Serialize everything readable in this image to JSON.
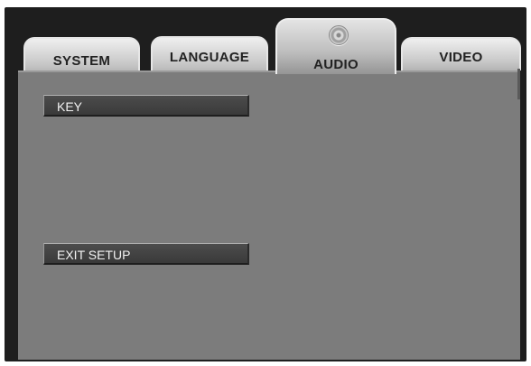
{
  "tabs": {
    "system": "SYSTEM",
    "language": "LANGUAGE",
    "audio": "AUDIO",
    "video": "VIDEO"
  },
  "active_tab": "AUDIO",
  "active_tab_icon": "disc-icon",
  "menu": {
    "items": [
      "KEY",
      "EXIT SETUP"
    ]
  }
}
